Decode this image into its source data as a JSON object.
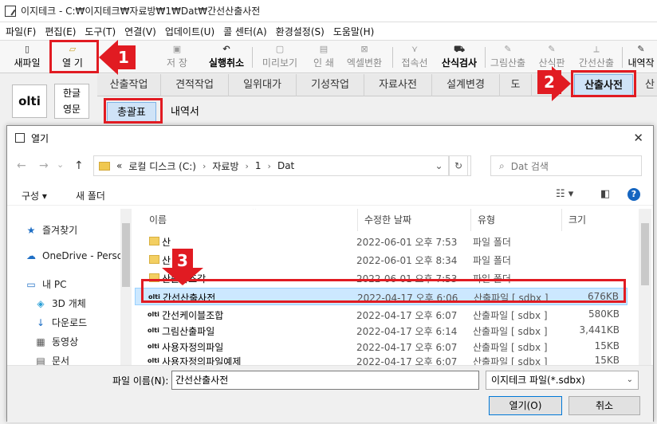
{
  "app": {
    "title": "이지테크 - C:₩이지테크₩자료방₩1₩Dat₩간선산출사전"
  },
  "menu": [
    "파일(F)",
    "편집(E)",
    "도구(T)",
    "연결(V)",
    "업데이트(U)",
    "콜 센터(A)",
    "환경설정(S)",
    "도움말(H)"
  ],
  "toolbar": {
    "new_file": "새파일",
    "open": "열 기",
    "save": "저 장",
    "undo": "실행취소",
    "preview": "미리보기",
    "print": "인 쇄",
    "excel": "엑셀변환",
    "connect": "접속선",
    "calc_check": "산식검사",
    "draw_calc": "그림산출",
    "calc_board": "산식판",
    "trunk_calc": "간선산출",
    "details": "내역작"
  },
  "side": {
    "logo_text": "olti",
    "lang_ko": "한글",
    "lang_en": "영문"
  },
  "tabs": [
    "산출작업",
    "견적작업",
    "일위대가",
    "기성작업",
    "자료사전",
    "설계변경",
    "도",
    "산출사전",
    "산"
  ],
  "subtabs": [
    "총괄표",
    "내역서"
  ],
  "dialog": {
    "title": "열기",
    "path": [
      "«",
      "로컬 디스크 (C:)",
      "자료방",
      "1",
      "Dat"
    ],
    "search_placeholder": "Dat 검색",
    "organize": "구성 ▾",
    "new_folder": "새 폴더",
    "help": "?",
    "tree": [
      {
        "label": "즐겨찾기",
        "icon": "★"
      },
      {
        "label": "OneDrive - Person",
        "icon": "☁"
      },
      {
        "label": "내 PC",
        "icon": "▭"
      },
      {
        "label": "3D 개체",
        "icon": "◈"
      },
      {
        "label": "다운로드",
        "icon": "↓"
      },
      {
        "label": "동영상",
        "icon": "▦"
      },
      {
        "label": "문서",
        "icon": "▤"
      }
    ],
    "columns": {
      "name": "이름",
      "date": "수정한 날짜",
      "type": "유형",
      "size": "크기"
    },
    "rows": [
      {
        "name": "산",
        "date": "2022-06-01 오후 7:53",
        "type": "파일 폴더",
        "size": "",
        "kind": "folder"
      },
      {
        "name": "산",
        "date": "2022-06-01 오후 8:34",
        "type": "파일 폴더",
        "size": "",
        "kind": "folder"
      },
      {
        "name": "산출사조각",
        "date": "2022-06-01 오후 7:53",
        "type": "파일 폴더",
        "size": "",
        "kind": "folder"
      },
      {
        "name": "간선산출사전",
        "date": "2022-04-17 오후 6:06",
        "type": "산출파일 [ sdbx ]",
        "size": "676KB",
        "kind": "file"
      },
      {
        "name": "간선케이블조합",
        "date": "2022-04-17 오후 6:07",
        "type": "산출파일 [ sdbx ]",
        "size": "580KB",
        "kind": "file"
      },
      {
        "name": "그림산출파일",
        "date": "2022-04-17 오후 6:14",
        "type": "산출파일 [ sdbx ]",
        "size": "3,441KB",
        "kind": "file"
      },
      {
        "name": "사용자정의파일",
        "date": "2022-04-17 오후 6:07",
        "type": "산출파일 [ sdbx ]",
        "size": "15KB",
        "kind": "file"
      },
      {
        "name": "사용자정의파일예제",
        "date": "2022-04-17 오후 6:07",
        "type": "산출파일 [ sdbx ]",
        "size": "15KB",
        "kind": "file"
      }
    ],
    "filename_label": "파일 이름(N):",
    "filename_value": "간선산출사전",
    "filetype": "이지테크 파일(*.sdbx)",
    "open_btn": "열기(O)",
    "cancel_btn": "취소"
  },
  "annotations": {
    "step1": "1",
    "step2": "2",
    "step3": "3"
  },
  "colors": {
    "highlight": "#e11b22",
    "selected_row": "#cce8ff",
    "active_tab": "#cfe3f7"
  }
}
